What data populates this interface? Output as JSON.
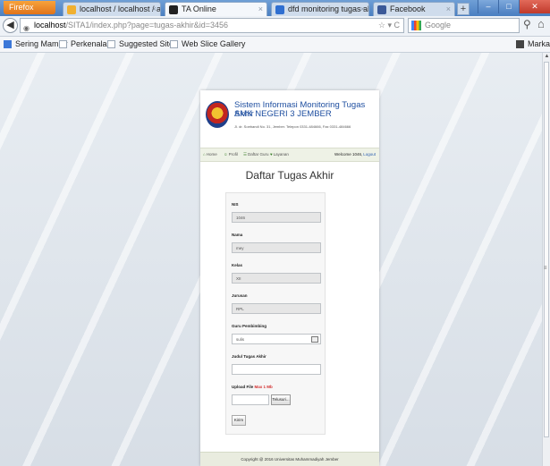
{
  "browser": {
    "firefox_label": "Firefox",
    "tabs": [
      {
        "label": "localhost / localhost / apli..."
      },
      {
        "label": "TA Online"
      },
      {
        "label": "dfd monitoring tugas akhi..."
      },
      {
        "label": "Facebook"
      }
    ],
    "new_tab": "+",
    "url_host": "localhost",
    "url_path": "/SITA1/index.php?page=tugas-akhir&id=3456",
    "search_engine": "Google",
    "bookmarks": [
      {
        "label": "Sering Mampir"
      },
      {
        "label": "Perkenalan"
      },
      {
        "label": "Suggested Sites"
      },
      {
        "label": "Web Slice Gallery"
      },
      {
        "label": "Markah"
      }
    ]
  },
  "site": {
    "title": "Sistem Informasi Monitoring Tugas Akhir",
    "school": "SMK NEGERI 3 JEMBER",
    "address": "Jl. dr. Soebandi No. 31, Jember. Telepon 0331-484666, Fax 0331-484666",
    "menu": [
      {
        "icon": "⌂",
        "label": "Home"
      },
      {
        "icon": "☺",
        "label": "Profil"
      },
      {
        "icon": "☰",
        "label": "Daftar Guru"
      },
      {
        "icon": "♥",
        "label": "Layanan"
      }
    ],
    "welcome": "Welcome 1046,",
    "logout": "Logout",
    "footer": "Copyright @ 2016 Universitas Muhammadiyah Jember"
  },
  "form": {
    "heading": "Daftar Tugas Akhir",
    "nis_label": "NIS",
    "nis_value": "1046",
    "nama_label": "Nama",
    "nama_value": "mey",
    "kelas_label": "Kelas",
    "kelas_value": "XII",
    "jurusan_label": "Jurusan",
    "jurusan_value": "RPL",
    "guru_label": "Guru Pembimbing",
    "guru_value": "sulis",
    "judul_label": "Judul Tugas Akhir",
    "judul_value": "",
    "upload_label": "Upload File",
    "upload_limit": "Max 1 Mb",
    "browse_label": "Telusuri...",
    "submit_label": "Kirim"
  }
}
